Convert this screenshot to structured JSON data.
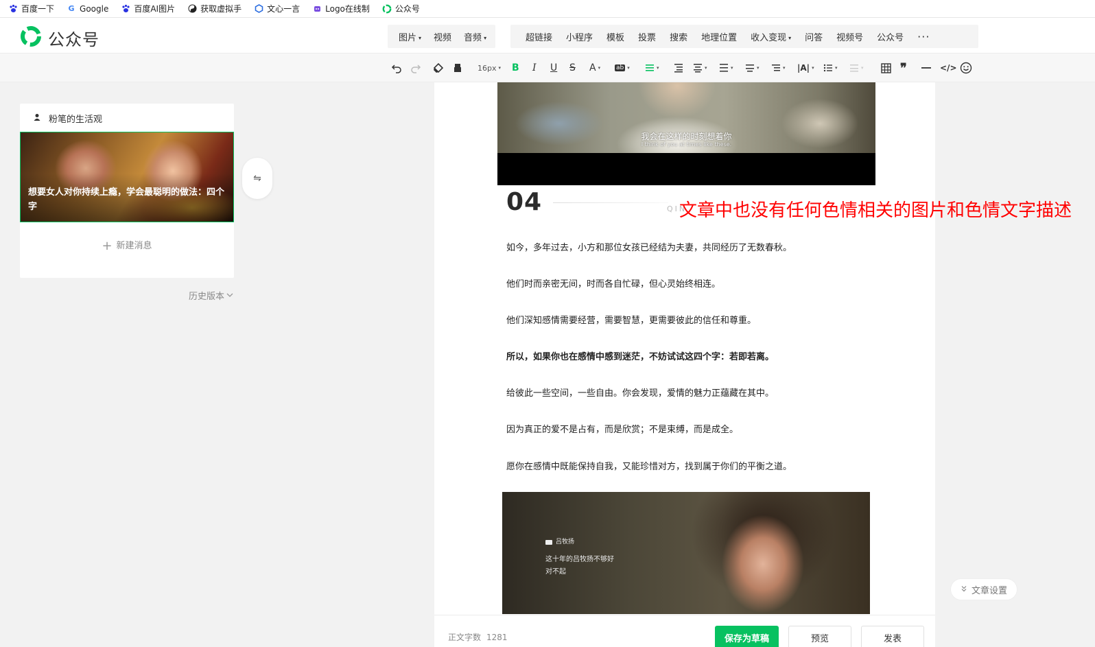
{
  "bookmarks": [
    {
      "label": "百度一下",
      "icon": "baidu-paw-icon",
      "color": "#2932e1"
    },
    {
      "label": "Google",
      "icon": "google-g-icon",
      "color": "#4285f4"
    },
    {
      "label": "百度AI图片",
      "icon": "baidu-paw-icon",
      "color": "#2932e1"
    },
    {
      "label": "获取虚拟手",
      "icon": "yin-yang-icon",
      "color": "#222222"
    },
    {
      "label": "文心一言",
      "icon": "hexagon-icon",
      "color": "#2b6de0"
    },
    {
      "label": "Logo在线制",
      "icon": "robot-icon",
      "color": "#7a4ee0"
    },
    {
      "label": "公众号",
      "icon": "wechat-mp-icon",
      "color": "#07c160"
    }
  ],
  "header": {
    "logo_text": "公众号",
    "insert_group1": [
      "图片",
      "视频",
      "音频"
    ],
    "insert_group1_dropdown": [
      true,
      false,
      true
    ],
    "insert_group2": [
      "超链接",
      "小程序",
      "模板",
      "投票",
      "搜索",
      "地理位置",
      "收入变现",
      "问答",
      "视频号",
      "公众号"
    ],
    "insert_group2_dropdown": [
      false,
      false,
      false,
      false,
      false,
      false,
      true,
      false,
      false,
      false
    ],
    "more_label": "···"
  },
  "toolbar": {
    "font_size": "16px",
    "accent_color": "#07c160"
  },
  "left": {
    "account_name": "粉笔的生活观",
    "article_title": "想要女人对你持续上瘾，学会最聪明的做法：四个字",
    "new_message": "新建消息",
    "history": "历史版本"
  },
  "editor": {
    "subtitle_cn": "我会在这样的时刻想着你",
    "subtitle_en": "I think of you at times like these.",
    "section_number": "04",
    "section_tag": "QIN",
    "annotation": "文章中也没有任何色情相关的图片和色情文字描述",
    "annotation_color": "#ff0000",
    "paragraphs": [
      {
        "text": "如今，多年过去，小方和那位女孩已经结为夫妻，共同经历了无数春秋。",
        "bold": false
      },
      {
        "text": "他们时而亲密无间，时而各自忙碌，但心灵始终相连。",
        "bold": false
      },
      {
        "text": "他们深知感情需要经营，需要智慧，更需要彼此的信任和尊重。",
        "bold": false
      },
      {
        "text": "所以，如果你也在感情中感到迷茫，不妨试试这四个字：若即若离。",
        "bold": true
      },
      {
        "text": "给彼此一些空间，一些自由。你会发现，爱情的魅力正蕴藏在其中。",
        "bold": false
      },
      {
        "text": "因为真正的爱不是占有，而是欣赏；不是束缚，而是成全。",
        "bold": false
      },
      {
        "text": "愿你在感情中既能保持自我，又能珍惜对方，找到属于你们的平衡之道。",
        "bold": false
      }
    ],
    "image2_sender": "吕牧扬",
    "image2_line1": "这十年的吕牧扬不够好",
    "image2_line2": "对不起"
  },
  "footer": {
    "word_count_label": "正文字数",
    "word_count": "1281",
    "save_draft": "保存为草稿",
    "preview": "预览",
    "publish": "发表",
    "article_settings": "文章设置"
  }
}
